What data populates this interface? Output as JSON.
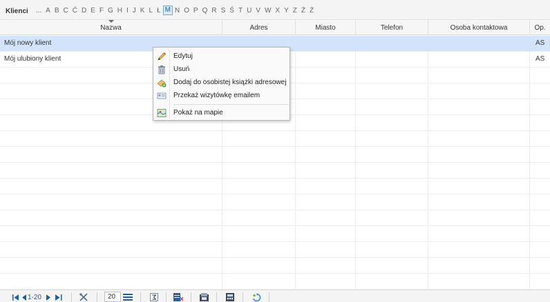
{
  "alphabet": {
    "title": "Klienci",
    "letters": [
      "...",
      "A",
      "B",
      "C",
      "Ć",
      "D",
      "E",
      "F",
      "G",
      "H",
      "I",
      "J",
      "K",
      "L",
      "Ł",
      "M",
      "N",
      "O",
      "P",
      "Q",
      "R",
      "S",
      "Ś",
      "T",
      "U",
      "V",
      "W",
      "X",
      "Y",
      "Z",
      "Ź",
      "Ż"
    ],
    "active_letter": "M"
  },
  "grid": {
    "columns": [
      "Nazwa",
      "Adres",
      "Miasto",
      "Telefon",
      "Osoba kontaktowa",
      "Op."
    ],
    "sorted_column": "Nazwa",
    "rows": [
      {
        "nazwa": "Mój nowy klient",
        "adres": "",
        "miasto": "",
        "telefon": "",
        "osoba": "",
        "op": "AS"
      },
      {
        "nazwa": "Mój ulubiony klient",
        "adres": "",
        "miasto": "",
        "telefon": "",
        "osoba": "",
        "op": "AS"
      }
    ]
  },
  "context_menu": {
    "items": [
      {
        "label": "Edytuj",
        "icon": "pencil-icon"
      },
      {
        "label": "Usuń",
        "icon": "trash-icon"
      },
      {
        "label": "Dodaj do osobistej książki adresowej",
        "icon": "add-contact-icon"
      },
      {
        "label": "Przekaż wizytówkę emailem",
        "icon": "vcard-icon"
      },
      {
        "label": "Pokaż na mapie",
        "icon": "map-icon"
      }
    ]
  },
  "footer": {
    "pagination": "1-20",
    "page_size": "20"
  },
  "colors": {
    "selected_row": "#d1e4fb",
    "accent": "#1a5fa8"
  }
}
